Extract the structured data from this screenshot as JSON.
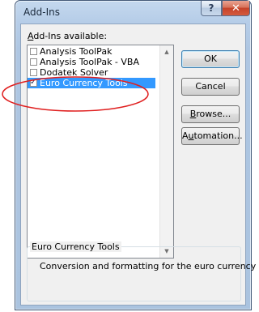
{
  "window": {
    "title": "Add-Ins",
    "help_glyph": "?",
    "close_glyph": "✕"
  },
  "addins": {
    "label_prefix": "",
    "label_access": "A",
    "label_rest": "dd-Ins available:",
    "items": [
      {
        "label": "Analysis ToolPak",
        "checked": false,
        "selected": false
      },
      {
        "label": "Analysis ToolPak - VBA",
        "checked": false,
        "selected": false
      },
      {
        "label": "Dodatek Solver",
        "checked": false,
        "selected": false
      },
      {
        "label": "Euro Currency Tools",
        "checked": true,
        "selected": true
      }
    ]
  },
  "buttons": {
    "ok": "OK",
    "cancel": "Cancel",
    "browse_access": "B",
    "browse_rest": "rowse...",
    "automation_pre": "A",
    "automation_access": "u",
    "automation_rest": "tomation..."
  },
  "description": {
    "title": "Euro Currency Tools",
    "text": "Conversion and formatting for the euro currency"
  },
  "annotation": {
    "color": "#e02020",
    "shape": "ellipse"
  }
}
